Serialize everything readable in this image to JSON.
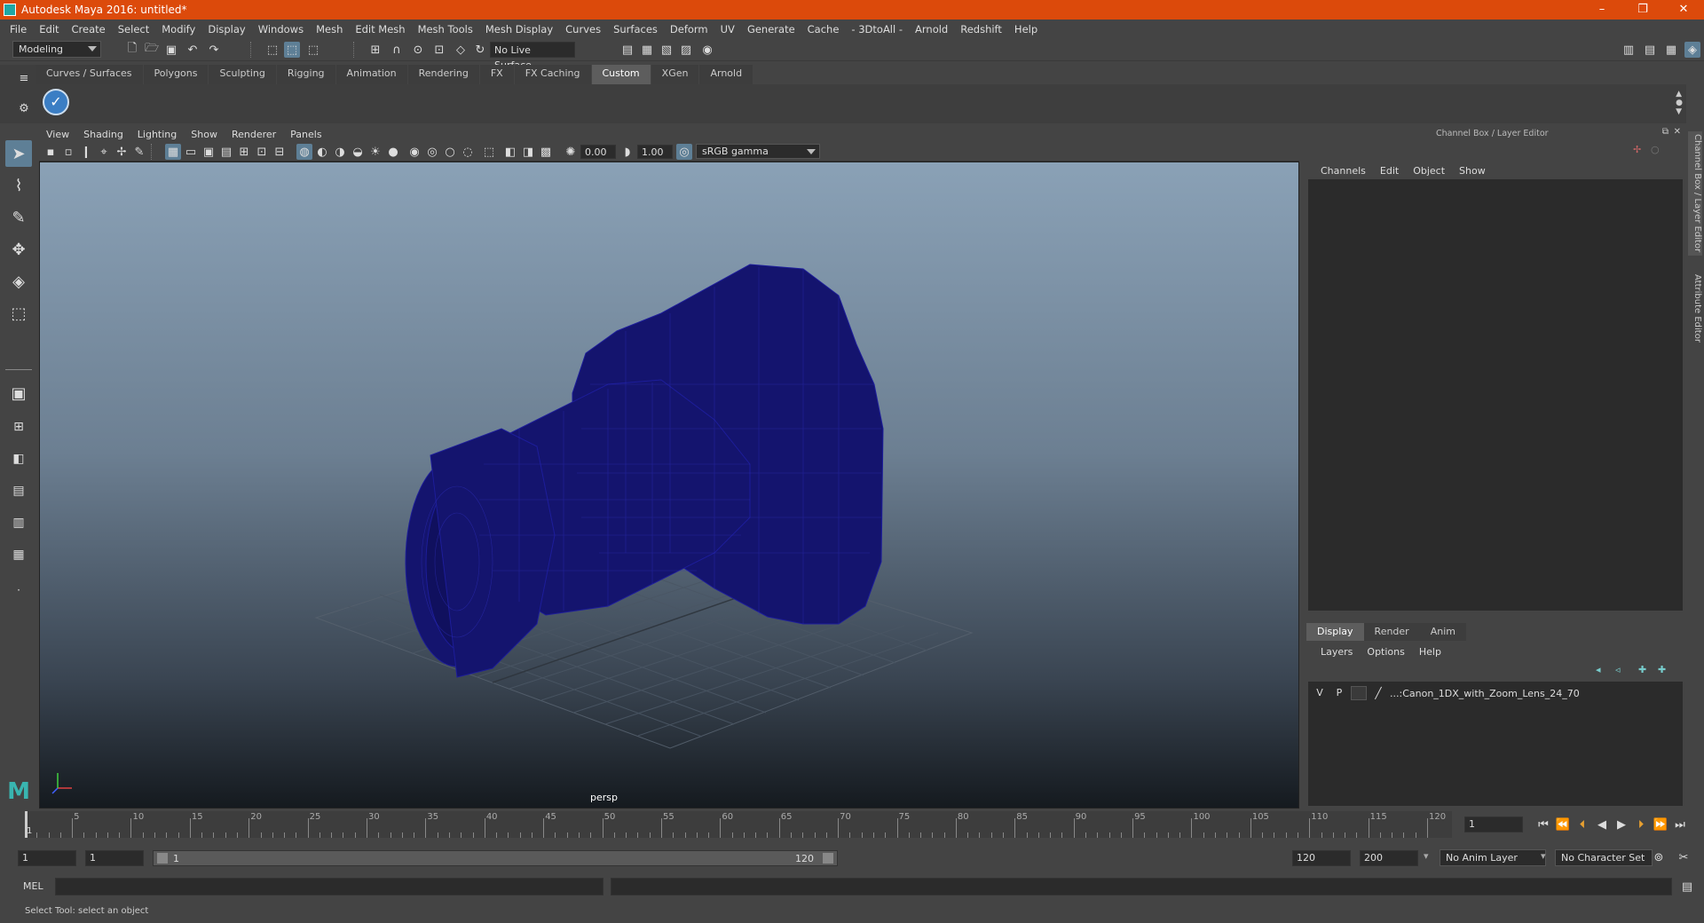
{
  "window": {
    "title": "Autodesk Maya 2016: untitled*",
    "controls": [
      "–",
      "❐",
      "✕"
    ]
  },
  "menu": [
    "File",
    "Edit",
    "Create",
    "Select",
    "Modify",
    "Display",
    "Windows",
    "Mesh",
    "Edit Mesh",
    "Mesh Tools",
    "Mesh Display",
    "Curves",
    "Surfaces",
    "Deform",
    "UV",
    "Generate",
    "Cache",
    "- 3DtoAll -",
    "Arnold",
    "Redshift",
    "Help"
  ],
  "status": {
    "mode": "Modeling",
    "live_surface": "No Live Surface"
  },
  "shelf": {
    "tabs": [
      "Curves / Surfaces",
      "Polygons",
      "Sculpting",
      "Rigging",
      "Animation",
      "Rendering",
      "FX",
      "FX Caching",
      "Custom",
      "XGen",
      "Arnold"
    ],
    "active": "Custom"
  },
  "viewport": {
    "menus": [
      "View",
      "Shading",
      "Lighting",
      "Show",
      "Renderer",
      "Panels"
    ],
    "exposure": "0.00",
    "gamma": "1.00",
    "color_space": "sRGB gamma",
    "camera": "persp",
    "axis_x": "x",
    "axis_y": "y",
    "axis_z": "z"
  },
  "channel_box": {
    "title": "Channel Box / Layer Editor",
    "menus": [
      "Channels",
      "Edit",
      "Object",
      "Show"
    ]
  },
  "side_tabs": [
    "Channel Box / Layer Editor",
    "Attribute Editor"
  ],
  "layers": {
    "tabs": [
      "Display",
      "Render",
      "Anim"
    ],
    "active": "Display",
    "menus": [
      "Layers",
      "Options",
      "Help"
    ],
    "rows": [
      {
        "v": "V",
        "p": "P",
        "name": "...:Canon_1DX_with_Zoom_Lens_24_70"
      }
    ]
  },
  "timeline": {
    "labels": [
      "5",
      "10",
      "15",
      "20",
      "25",
      "30",
      "35",
      "40",
      "45",
      "50",
      "55",
      "60",
      "65",
      "70",
      "75",
      "80",
      "85",
      "90",
      "95",
      "100",
      "105",
      "110",
      "115",
      "120"
    ],
    "current_frame": "1",
    "start_label": "1"
  },
  "range": {
    "start": "1",
    "inner_start": "1",
    "slider_start": "1",
    "slider_end": "120",
    "end": "120",
    "max_end": "200",
    "anim_layer": "No Anim Layer",
    "char_set": "No Character Set"
  },
  "command_line": {
    "label": "MEL",
    "help": "Select Tool: select an object"
  }
}
